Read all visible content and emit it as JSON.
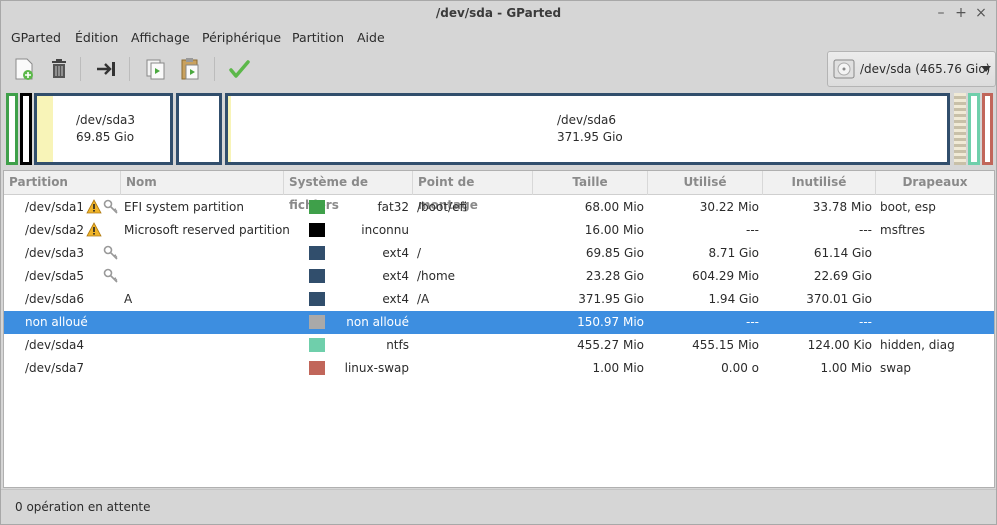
{
  "window": {
    "title": "/dev/sda - GParted"
  },
  "menu": [
    "GParted",
    "Édition",
    "Affichage",
    "Périphérique",
    "Partition",
    "Aide"
  ],
  "toolbar": {
    "buttons": [
      "new-partition-icon",
      "delete-icon",
      "resize-move-icon",
      "copy-icon",
      "paste-icon",
      "apply-icon"
    ]
  },
  "device": {
    "label": "/dev/sda (465.76 Gio)"
  },
  "map": {
    "sda3": {
      "name": "/dev/sda3",
      "size": "69.85 Gio"
    },
    "sda6": {
      "name": "/dev/sda6",
      "size": "371.95 Gio"
    }
  },
  "table": {
    "headers": [
      "Partition",
      "Nom",
      "Système de fichiers",
      "Point de montage",
      "Taille",
      "Utilisé",
      "Inutilisé",
      "Drapeaux"
    ],
    "rows": [
      {
        "partition": "/dev/sda1",
        "warn": true,
        "key": true,
        "name": "EFI system partition",
        "color": "#3fa04a",
        "fs": "fat32",
        "mount": "/boot/efi",
        "size": "68.00 Mio",
        "used": "30.22 Mio",
        "unused": "33.78 Mio",
        "flags": "boot, esp"
      },
      {
        "partition": "/dev/sda2",
        "warn": true,
        "key": false,
        "name": "Microsoft reserved partition",
        "color": "#000000",
        "fs": "inconnu",
        "mount": "",
        "size": "16.00 Mio",
        "used": "---",
        "unused": "---",
        "flags": "msftres"
      },
      {
        "partition": "/dev/sda3",
        "warn": false,
        "key": true,
        "name": "",
        "color": "#314e6c",
        "fs": "ext4",
        "mount": "/",
        "size": "69.85 Gio",
        "used": "8.71 Gio",
        "unused": "61.14 Gio",
        "flags": ""
      },
      {
        "partition": "/dev/sda5",
        "warn": false,
        "key": true,
        "name": "",
        "color": "#314e6c",
        "fs": "ext4",
        "mount": "/home",
        "size": "23.28 Gio",
        "used": "604.29 Mio",
        "unused": "22.69 Gio",
        "flags": ""
      },
      {
        "partition": "/dev/sda6",
        "warn": false,
        "key": false,
        "name": "A",
        "color": "#314e6c",
        "fs": "ext4",
        "mount": "/A",
        "size": "371.95 Gio",
        "used": "1.94 Gio",
        "unused": "370.01 Gio",
        "flags": ""
      },
      {
        "partition": "non alloué",
        "warn": false,
        "key": false,
        "name": "",
        "color": "#a9a9a9",
        "fs": "non alloué",
        "mount": "",
        "size": "150.97 Mio",
        "used": "---",
        "unused": "---",
        "flags": "",
        "selected": true
      },
      {
        "partition": "/dev/sda4",
        "warn": false,
        "key": false,
        "name": "",
        "color": "#6fcfab",
        "fs": "ntfs",
        "mount": "",
        "size": "455.27 Mio",
        "used": "455.15 Mio",
        "unused": "124.00 Kio",
        "flags": "hidden, diag"
      },
      {
        "partition": "/dev/sda7",
        "warn": false,
        "key": false,
        "name": "",
        "color": "#c1665a",
        "fs": "linux-swap",
        "mount": "",
        "size": "1.00 Mio",
        "used": "0.00 o",
        "unused": "1.00 Mio",
        "flags": "swap"
      }
    ]
  },
  "status": {
    "text": "0 opération en attente"
  },
  "colors": {
    "selection": "#3d8ee0",
    "ext4": "#314e6c",
    "fat32": "#3fa04a",
    "ntfs": "#6fcfab",
    "swap": "#c1665a",
    "unallocated": "#a9a9a9"
  }
}
